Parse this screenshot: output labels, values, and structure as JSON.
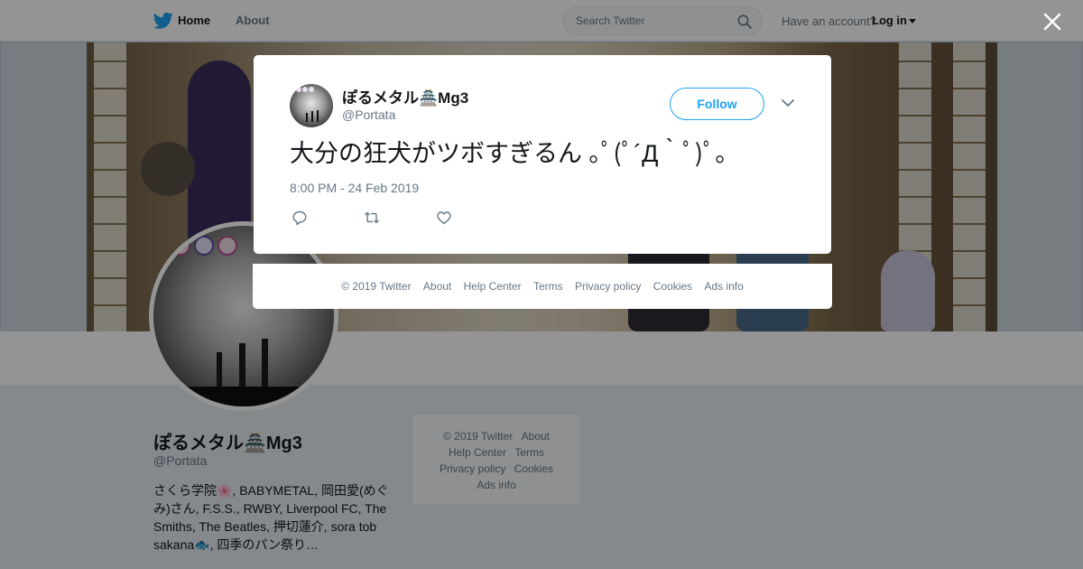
{
  "topbar": {
    "home_label": "Home",
    "about_label": "About",
    "search_placeholder": "Search Twitter",
    "account_prompt": "Have an account?",
    "login_label": "Log in"
  },
  "profile": {
    "name": "ぽるメタル🏯Mg3",
    "handle": "@Portata",
    "bio": "さくら学院🌸, BABYMETAL, 岡田愛(めぐみ)さん, F.S.S., RWBY, Liverpool FC, The Smiths, The Beatles, 押切蓮介, sora tob sakana🐟, 四季のパン祭り…"
  },
  "sidebar_footer": {
    "items": [
      "© 2019 Twitter",
      "About",
      "Help Center",
      "Terms",
      "Privacy policy",
      "Cookies",
      "Ads info"
    ]
  },
  "tweet": {
    "author_name": "ぽるメタル🏯Mg3",
    "author_handle": "@Portata",
    "follow_label": "Follow",
    "text": "大分の狂犬がツボすぎるん ｡ﾟ(ﾟ´Д｀ﾟ)ﾟ｡",
    "timestamp": "8:00 PM - 24 Feb 2019"
  },
  "modal_footer": {
    "items": [
      "© 2019 Twitter",
      "About",
      "Help Center",
      "Terms",
      "Privacy policy",
      "Cookies",
      "Ads info"
    ]
  },
  "colors": {
    "brand": "#1da1f2",
    "text_primary": "#14171a",
    "text_secondary": "#657786",
    "overlay": "rgba(0,0,0,0.42)"
  },
  "icons": {
    "brand": "twitter-bird-icon",
    "search": "search-icon",
    "close": "close-icon",
    "chevron": "chevron-down-icon",
    "reply": "reply-icon",
    "retweet": "retweet-icon",
    "like": "heart-icon"
  }
}
